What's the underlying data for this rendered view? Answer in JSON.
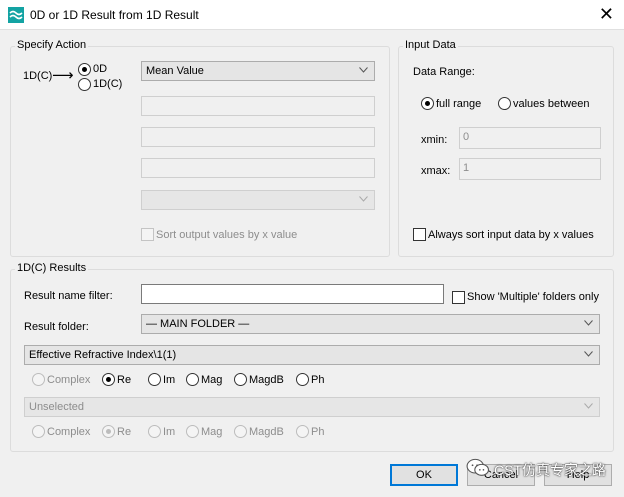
{
  "window": {
    "title": "0D or 1D Result from 1D Result",
    "close_glyph": "✕"
  },
  "specify_action": {
    "title": "Specify Action",
    "source_label": "1D(C)",
    "arrow": "⟶",
    "option_0d": "0D",
    "option_1dc": "1D(C)",
    "operation_value": "Mean Value",
    "sort_label": "Sort output values by x value"
  },
  "input_data": {
    "title": "Input Data",
    "range_label": "Data Range:",
    "full_range": "full range",
    "values_between": "values between",
    "xmin_label": "xmin:",
    "xmin_value": "0",
    "xmax_label": "xmax:",
    "xmax_value": "1",
    "always_sort": "Always sort input data by x values"
  },
  "results": {
    "title": "1D(C) Results",
    "filter_label": "Result name filter:",
    "filter_value": "",
    "multiple_label": "Show 'Multiple' folders only",
    "folder_label": "Result folder:",
    "folder_value": "— MAIN FOLDER —",
    "result_value": "Effective Refractive Index\\1(1)",
    "row1": {
      "complex": "Complex",
      "re": "Re",
      "im": "Im",
      "mag": "Mag",
      "magdb": "MagdB",
      "ph": "Ph"
    },
    "second_value": "Unselected",
    "row2": {
      "complex": "Complex",
      "re": "Re",
      "im": "Im",
      "mag": "Mag",
      "magdb": "MagdB",
      "ph": "Ph"
    }
  },
  "buttons": {
    "ok": "OK",
    "cancel": "Cancel",
    "help": "Help"
  },
  "watermark": {
    "text": "CST仿真专家之路"
  }
}
